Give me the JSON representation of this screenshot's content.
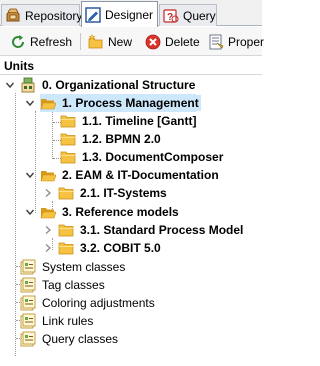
{
  "tabs": [
    {
      "label": "Repository",
      "icon": "repository-icon",
      "active": false
    },
    {
      "label": "Designer",
      "icon": "designer-icon",
      "active": true
    },
    {
      "label": "Query",
      "icon": "query-icon",
      "active": false
    }
  ],
  "toolbar": {
    "refresh_label": "Refresh",
    "new_label": "New",
    "delete_label": "Delete",
    "properties_label": "Proper"
  },
  "units_header": "Units",
  "tree": {
    "root": "0. Organizational Structure",
    "process_management": "1. Process Management",
    "timeline": "1.1. Timeline [Gantt]",
    "bpmn": "1.2. BPMN 2.0",
    "document_composer": "1.3. DocumentComposer",
    "eam": "2. EAM & IT-Documentation",
    "it_systems": "2.1. IT-Systems",
    "reference_models": "3. Reference models",
    "standard_process_model": "3.1. Standard Process Model",
    "cobit": "3.2. COBIT 5.0",
    "system_classes": "System classes",
    "tag_classes": "Tag classes",
    "coloring_adjustments": "Coloring adjustments",
    "link_rules": "Link rules",
    "query_classes": "Query classes"
  },
  "colors": {
    "folder": "#f5c242",
    "folder_dark": "#d99a1c",
    "selection": "#cde8fb",
    "delete_red": "#d9342b"
  }
}
